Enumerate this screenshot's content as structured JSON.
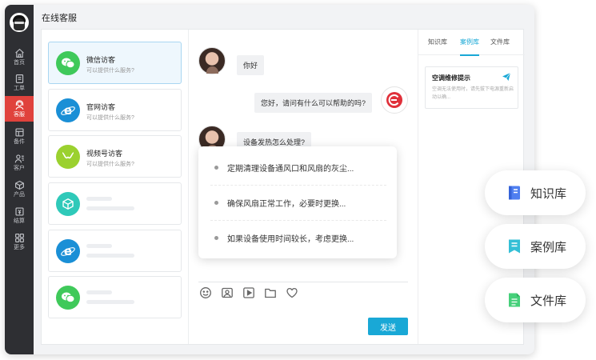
{
  "app": {
    "title": "在线客服"
  },
  "nav": [
    {
      "label": "首页",
      "icon": "home-icon"
    },
    {
      "label": "工单",
      "icon": "ticket-icon"
    },
    {
      "label": "客服",
      "icon": "service-icon",
      "active": true
    },
    {
      "label": "备件",
      "icon": "parts-icon"
    },
    {
      "label": "客户",
      "icon": "customer-icon"
    },
    {
      "label": "产品",
      "icon": "product-icon"
    },
    {
      "label": "结算",
      "icon": "settlement-icon"
    },
    {
      "label": "更多",
      "icon": "more-icon"
    }
  ],
  "visitors": [
    {
      "name": "微信访客",
      "subtitle": "可以提供什么服务?",
      "icon": "wechat-icon",
      "color": "#3fc95a"
    },
    {
      "name": "官网访客",
      "subtitle": "可以提供什么服务?",
      "icon": "ie-browser-icon",
      "color": "#1a8fd6"
    },
    {
      "name": "视频号访客",
      "subtitle": "可以提供什么服务?",
      "icon": "video-channel-icon",
      "color": "#9bd12f"
    },
    {
      "icon": "cube-icon",
      "color": "#2fc9b9"
    },
    {
      "icon": "ie-browser-icon",
      "color": "#1a8fd6"
    },
    {
      "icon": "wechat-icon",
      "color": "#3fc95a"
    }
  ],
  "messages": [
    {
      "from": "visitor",
      "text": "你好"
    },
    {
      "from": "agent",
      "text": "您好，请问有什么可以帮助的吗?"
    },
    {
      "from": "visitor",
      "text": "设备发热怎么处理?"
    }
  ],
  "suggestions": [
    "定期清理设备通风口和风扇的灰尘...",
    "确保风扇正常工作，必要时更换...",
    "如果设备使用时间较长，考虑更换..."
  ],
  "composer": {
    "tools": [
      "emoji-icon",
      "image-icon",
      "video-icon",
      "folder-icon",
      "heart-icon"
    ],
    "send_label": "发送"
  },
  "knowledge": {
    "tabs": [
      "知识库",
      "案例库",
      "文件库"
    ],
    "active_tab": "案例库",
    "card": {
      "title": "空调维修提示",
      "desc": "空调无法使用时，请先拔下电源重新启动以确..."
    }
  },
  "floating": [
    {
      "label": "知识库",
      "icon": "knowledge-book-icon",
      "color": "#4f7ff0"
    },
    {
      "label": "案例库",
      "icon": "case-doc-icon",
      "color": "#34bfd6"
    },
    {
      "label": "文件库",
      "icon": "file-doc-icon",
      "color": "#46d07a"
    }
  ],
  "colors": {
    "accent": "#19a8d6",
    "nav_active": "#e0423c",
    "nav_bg": "#2e2f33"
  }
}
